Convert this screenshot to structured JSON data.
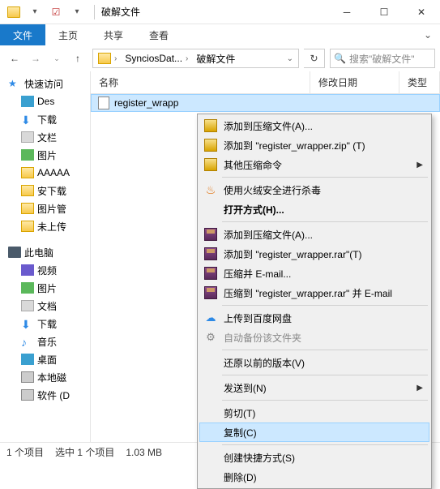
{
  "titlebar": {
    "title": "破解文件"
  },
  "ribbon": {
    "file": "文件",
    "home": "主页",
    "share": "共享",
    "view": "查看"
  },
  "address": {
    "seg1": "SynciosDat...",
    "seg2": "破解文件",
    "search_placeholder": "搜索\"破解文件\""
  },
  "columns": {
    "name": "名称",
    "date": "修改日期",
    "type": "类型"
  },
  "sidebar": {
    "quick": "快速访问",
    "items1": [
      "Des",
      "下载",
      "文栏",
      "图片",
      "AAAAA",
      "安下载",
      "图片管",
      "未上传"
    ],
    "pc": "此电脑",
    "items2": [
      "视频",
      "图片",
      "文档",
      "下载",
      "音乐",
      "桌面",
      "本地磁",
      "软件 (D"
    ]
  },
  "file": {
    "name": "register_wrapp"
  },
  "status": {
    "count": "1 个项目",
    "selected": "选中 1 个项目",
    "size": "1.03 MB"
  },
  "ctx": {
    "add_archive": "添加到压缩文件(A)...",
    "add_zip": "添加到 \"register_wrapper.zip\" (T)",
    "other_zip": "其他压缩命令",
    "huorong": "使用火绒安全进行杀毒",
    "open_with": "打开方式(H)...",
    "add_rar": "添加到压缩文件(A)...",
    "add_rar2": "添加到 \"register_wrapper.rar\"(T)",
    "email": "压缩并 E-mail...",
    "email_rar": "压缩到 \"register_wrapper.rar\" 并 E-mail",
    "baidu": "上传到百度网盘",
    "backup": "自动备份该文件夹",
    "restore": "还原以前的版本(V)",
    "sendto": "发送到(N)",
    "cut": "剪切(T)",
    "copy": "复制(C)",
    "shortcut": "创建快捷方式(S)",
    "delete": "删除(D)"
  }
}
